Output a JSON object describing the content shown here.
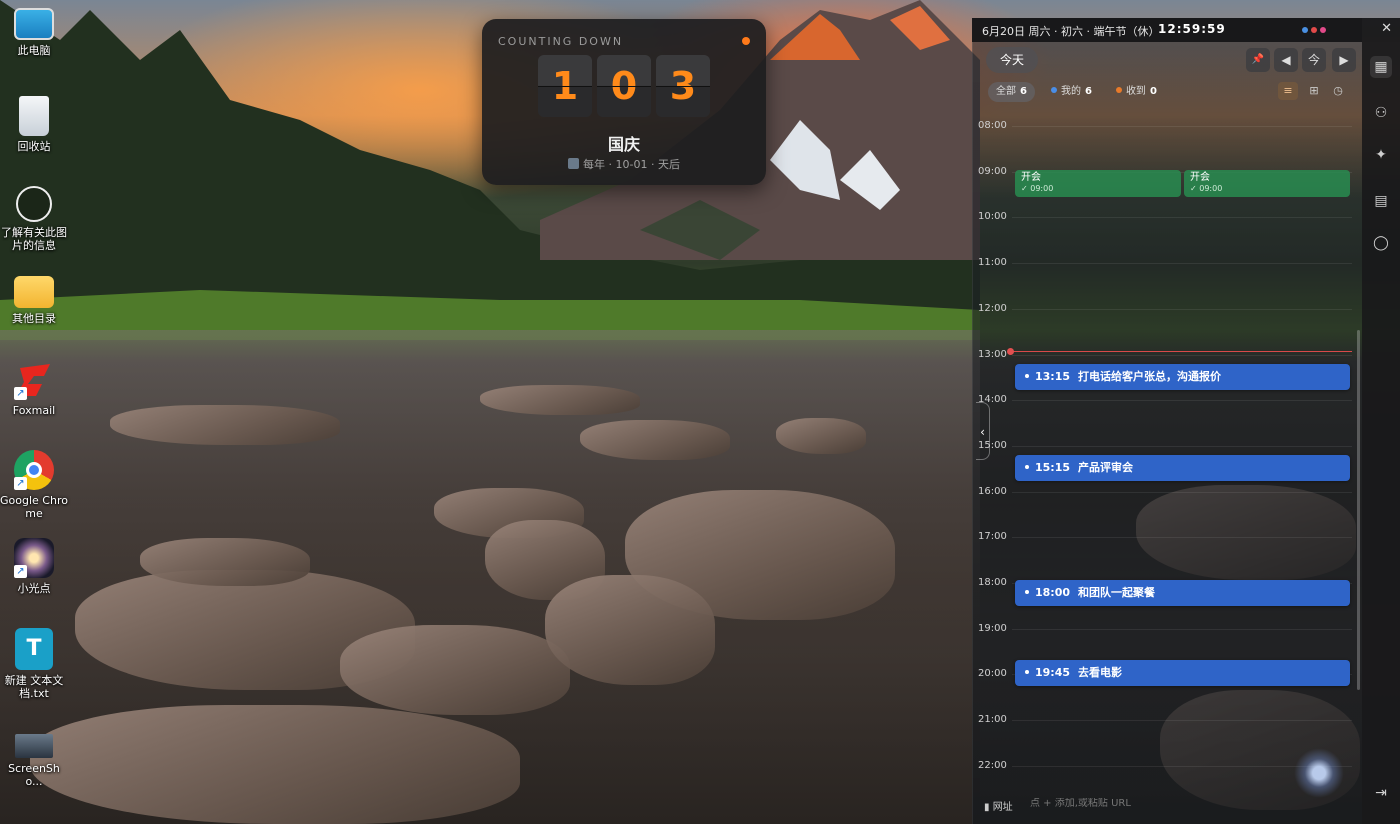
{
  "desktop": {
    "icons": [
      {
        "label": "此电脑"
      },
      {
        "label": "回收站"
      },
      {
        "label": "了解有关此图片的信息"
      },
      {
        "label": "其他目录"
      },
      {
        "label": "Foxmail"
      },
      {
        "label": "Google Chrome"
      },
      {
        "label": "小光点"
      },
      {
        "label": "新建 文本文档.txt"
      },
      {
        "label": "ScreenSho..."
      }
    ]
  },
  "countdown": {
    "title": "COUNTING DOWN",
    "digits": [
      "1",
      "0",
      "3"
    ],
    "name": "国庆",
    "subtitle": "每年 · 10-01 · 天后",
    "accent_color": "#ff8a1a"
  },
  "calendar": {
    "topbar": {
      "date": "6月20日 周六 · 初六 · 端午节（休）",
      "time": "12:59:59",
      "close_icon": "✕"
    },
    "today_label": "今天",
    "nav": {
      "pin": "📌",
      "prev": "◀",
      "today_icon": "今",
      "next": "▶"
    },
    "filters": [
      {
        "label": "全部",
        "count": "6"
      },
      {
        "label": "我的",
        "count": "6",
        "color": "#4a8ee8"
      },
      {
        "label": "收到",
        "count": "0",
        "color": "#e87a2a"
      }
    ],
    "views": {
      "list": "≡",
      "grid": "⊞",
      "clock": "◷"
    },
    "hours": [
      "08:00",
      "09:00",
      "10:00",
      "11:00",
      "12:00",
      "13:00",
      "14:00",
      "15:00",
      "16:00",
      "17:00",
      "18:00",
      "19:00",
      "20:00",
      "21:00",
      "22:00"
    ],
    "green_events": [
      {
        "title": "开会",
        "time": "✓ 09:00"
      },
      {
        "title": "开会",
        "time": "✓ 09:00"
      }
    ],
    "events": [
      {
        "time": "13:15",
        "title": "打电话给客户张总，沟通报价"
      },
      {
        "time": "15:15",
        "title": "产品评审会"
      },
      {
        "time": "18:00",
        "title": "和团队一起聚餐"
      },
      {
        "time": "19:45",
        "title": "去看电影"
      }
    ],
    "event_color": "#2f64c8",
    "now_color": "#e25050",
    "bottom": {
      "bookmark_label": "网址",
      "input_placeholder": "点 + 添加,或粘贴 URL"
    }
  },
  "sidebar": {
    "icons": [
      "calendar-icon",
      "contacts-icon",
      "sparkle-icon",
      "notes-icon",
      "user-icon",
      "logout-icon"
    ]
  }
}
